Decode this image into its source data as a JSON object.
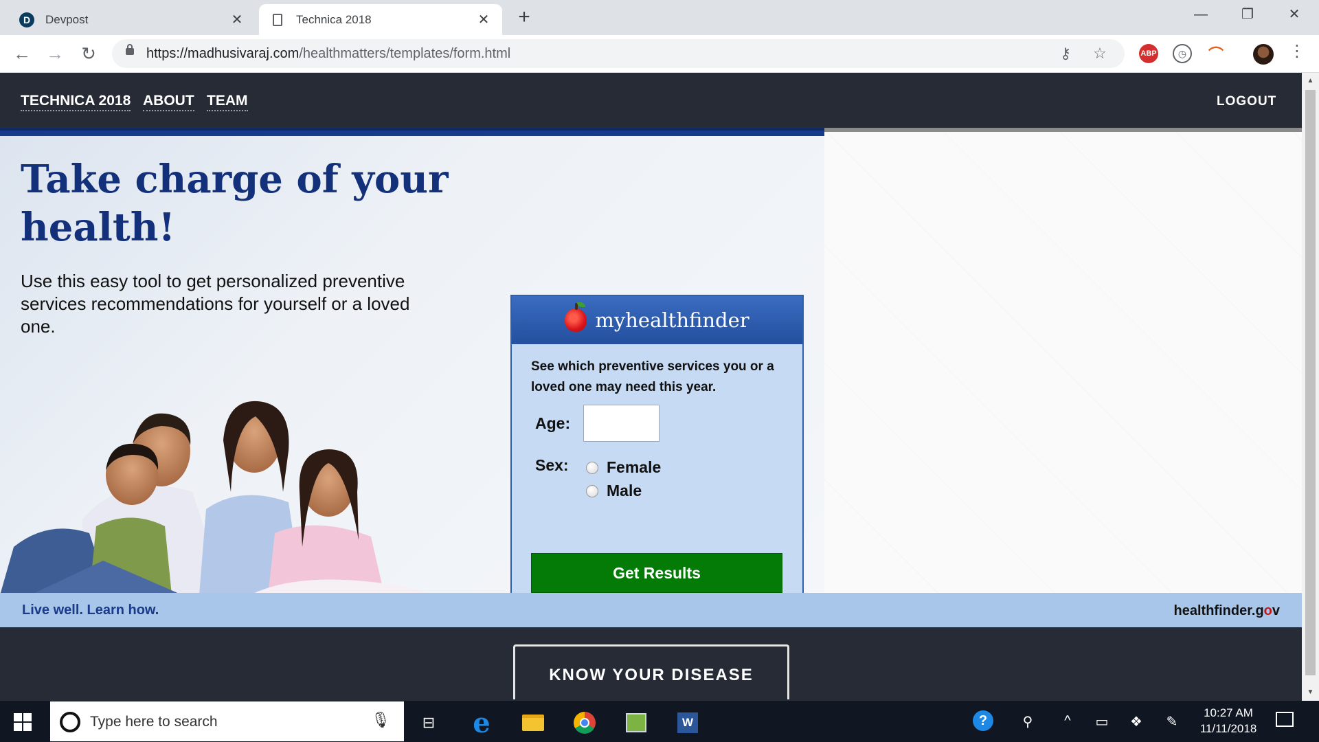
{
  "browser": {
    "tabs": [
      {
        "title": "Devpost",
        "favicon": "D"
      },
      {
        "title": "Technica 2018"
      }
    ],
    "new_tab_symbol": "+",
    "url_host": "https://madhusivaraj.com",
    "url_path": "/healthmatters/templates/form.html",
    "extensions": {
      "abp": "ABP"
    }
  },
  "site_nav": {
    "links": [
      "TECHNICA 2018",
      "ABOUT",
      "TEAM"
    ],
    "logout": "LOGOUT"
  },
  "hero": {
    "headline": "Take charge of your health!",
    "subhead": "Use this easy tool to get personalized preventive services recommendations for yourself or a loved one."
  },
  "widget": {
    "brand": "myhealthfinder",
    "intro": "See which preventive services you or a loved one may need this year.",
    "age_label": "Age:",
    "age_value": "",
    "sex_label": "Sex:",
    "sex_options": [
      "Female",
      "Male"
    ],
    "submit_label": "Get Results"
  },
  "footer_strip": {
    "tagline": "Live well. Learn how.",
    "logo_prefix": "healthfinder.g",
    "logo_o": "o",
    "logo_suffix": "v"
  },
  "section": {
    "button_label": "KNOW YOUR DISEASE"
  },
  "taskbar": {
    "search_placeholder": "Type here to search",
    "time": "10:27 AM",
    "date": "11/11/2018",
    "word_letter": "W"
  },
  "colors": {
    "nav_bg": "#262b36",
    "headline": "#13307a",
    "widget_bg": "#c6daf3",
    "widget_border": "#2d5fb0",
    "button_green": "#047a07",
    "strip_bg": "#a8c6ea"
  }
}
